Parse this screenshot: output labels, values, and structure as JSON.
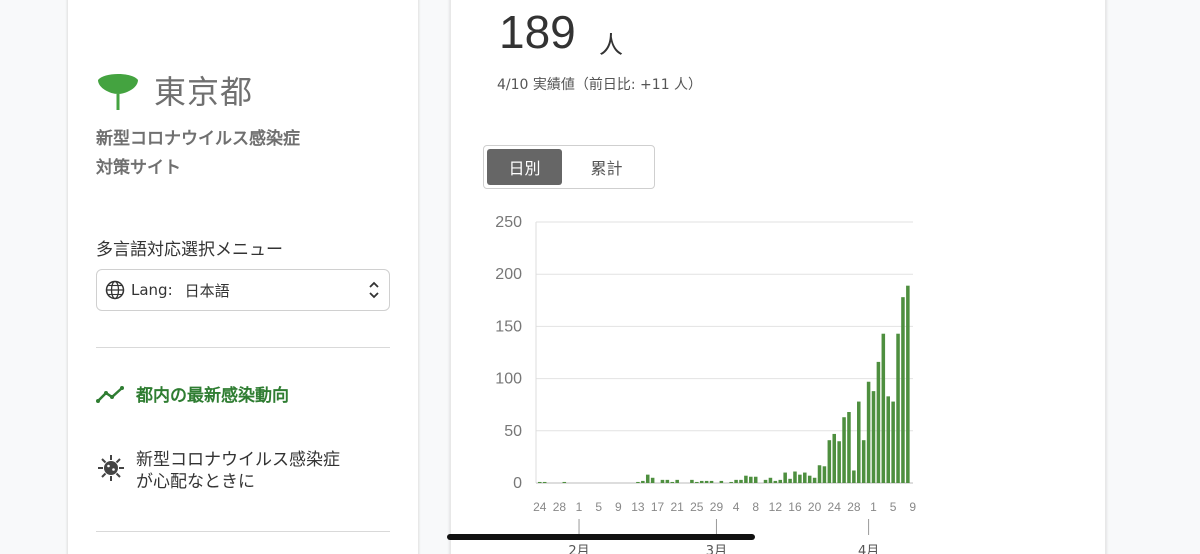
{
  "sidebar": {
    "logo_text": "東京都",
    "site_title_line1": "新型コロナウイルス感染症",
    "site_title_line2": "対策サイト",
    "lang_menu_label": "多言語対応選択メニュー",
    "lang_prefix": "Lang:",
    "lang_value": "日本語",
    "nav": [
      {
        "label": "都内の最新感染動向",
        "icon": "chart-line-icon",
        "active": true
      },
      {
        "label_line1": "新型コロナウイルス感染症",
        "label_line2": "が心配なときに",
        "icon": "virus-icon",
        "active": false
      }
    ]
  },
  "main": {
    "value": "189",
    "unit": "人",
    "subtext": "4/10 実績値（前日比: +11 人）",
    "toggle": {
      "daily": "日別",
      "cumulative": "累計",
      "selected": "daily"
    }
  },
  "colors": {
    "accent": "#2f7d32",
    "bar": "#4e8f3f",
    "logo": "#44a340"
  },
  "chart_data": {
    "type": "bar",
    "title": "",
    "xlabel": "",
    "ylabel": "",
    "ylim": [
      0,
      250
    ],
    "yticks": [
      0,
      50,
      100,
      150,
      200,
      250
    ],
    "x_tick_labels": [
      "24",
      "28",
      "1",
      "5",
      "9",
      "13",
      "17",
      "21",
      "25",
      "29",
      "4",
      "8",
      "12",
      "16",
      "20",
      "24",
      "28",
      "1",
      "5",
      "9"
    ],
    "month_labels": [
      "2月",
      "3月",
      "4月"
    ],
    "grid": true,
    "values": [
      1,
      1,
      0,
      0,
      0,
      1,
      0,
      0,
      0,
      0,
      0,
      0,
      0,
      0,
      0,
      0,
      0,
      0,
      0,
      0,
      1,
      2,
      8,
      5,
      0,
      3,
      3,
      1,
      3,
      0,
      0,
      3,
      1,
      2,
      2,
      2,
      0,
      2,
      0,
      1,
      3,
      3,
      7,
      6,
      6,
      0,
      3,
      5,
      2,
      3,
      10,
      4,
      11,
      8,
      10,
      7,
      5,
      17,
      16,
      41,
      47,
      40,
      63,
      68,
      12,
      78,
      41,
      97,
      88,
      116,
      143,
      83,
      78,
      143,
      178,
      189
    ]
  }
}
